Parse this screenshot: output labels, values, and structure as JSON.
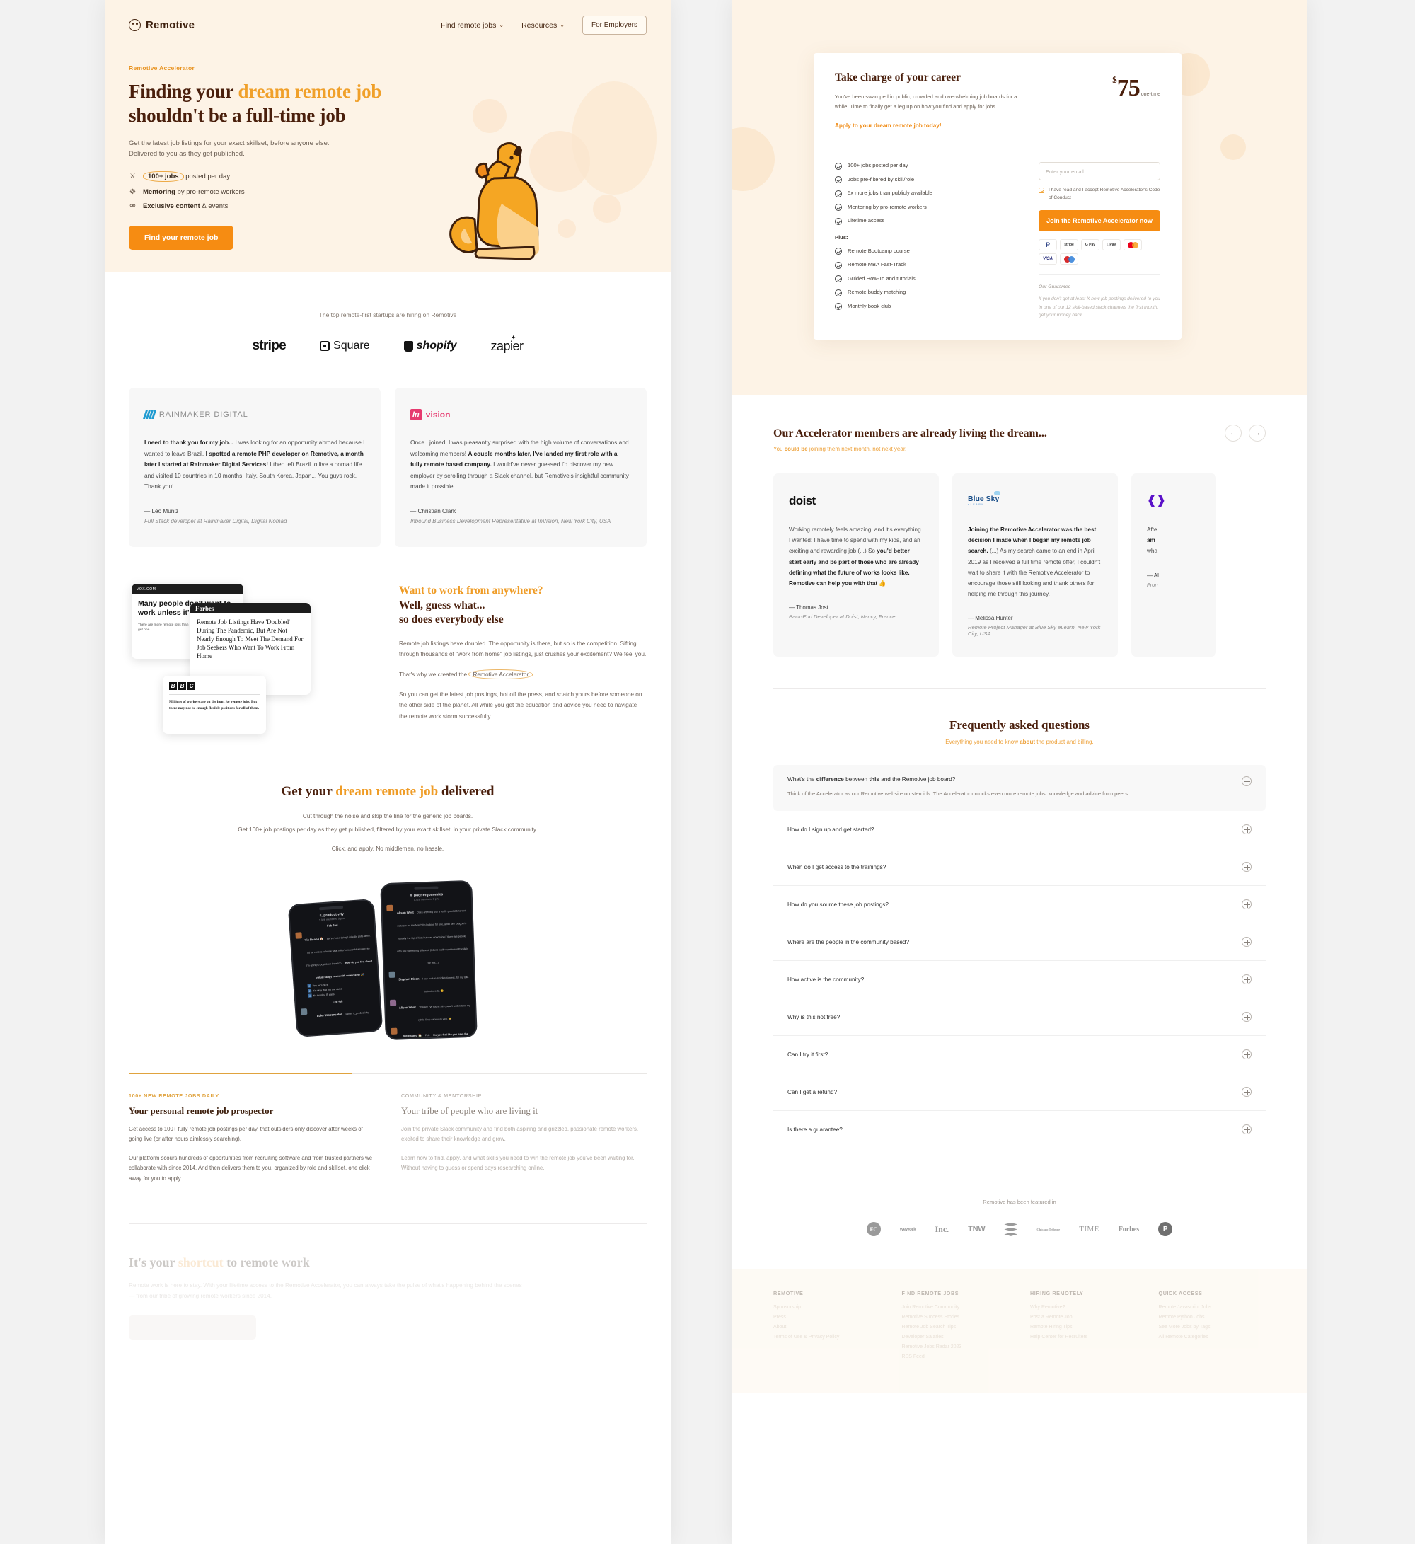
{
  "left": {
    "nav": {
      "brand": "Remotive",
      "links": [
        {
          "label": "Find remote jobs",
          "caret": "chevron-down-icon"
        },
        {
          "label": "Resources",
          "caret": "chevron-down-icon"
        }
      ],
      "employers_button": "For Employers"
    },
    "hero": {
      "eyebrow": "Remotive Accelerator",
      "title_1": "Finding your ",
      "title_accent": "dream remote job",
      "title_2": "shouldn't be a full-time job",
      "sub_line_1": "Get the latest job listings for your exact skillset, before anyone else.",
      "sub_line_2": "Delivered to you as they get published.",
      "features": [
        {
          "icon": "medal-icon",
          "strong": "100+ jobs",
          "rest": " posted per day",
          "circled": true
        },
        {
          "icon": "people-icon",
          "strong": "Mentoring",
          "rest": " by pro-remote workers",
          "circled": false
        },
        {
          "icon": "key-icon",
          "strong": "Exclusive content",
          "rest": " & events",
          "circled": false
        }
      ],
      "cta": "Find your remote job"
    },
    "logos": {
      "caption": "The top remote-first startups are hiring on Remotive",
      "items": [
        "stripe",
        "Square",
        "shopify",
        "zapier"
      ]
    },
    "testimonials": [
      {
        "company": "RAINMAKER DIGITAL",
        "company_part_1": "RAINMAKER",
        "company_part_2": "DIGITAL",
        "quote_bold_1": "I need to thank you for my job... ",
        "quote_plain_1": "I was looking for an opportunity abroad because I wanted to leave Brazil. ",
        "quote_bold_2": "I spotted a remote PHP developer on Remotive, a month later I started at Rainmaker Digital Services! ",
        "quote_plain_2": "I then left Brazil to live a nomad life and visited 10 countries in 10 months! Italy, South Korea, Japan... You guys rock. Thank you!",
        "author": "— Léo Muniz",
        "role": "Full Stack developer at Rainmaker Digital, Digital Nomad"
      },
      {
        "company": "InVision",
        "quote_plain_1": "Once I joined, I was pleasantly surprised with the high volume of conversations and welcoming members! ",
        "quote_bold_1": "A couple months later, I've landed my first role with a fully remote based company. ",
        "quote_plain_2": "I would've never guessed I'd discover my new employer by scrolling through a Slack channel, but Remotive's insightful community made it possible.",
        "author": "— Christian Clark",
        "role": "Inbound Business Development Representative at InVision, New York City, USA"
      }
    ],
    "press": {
      "cards": [
        {
          "source": "VOX.COM",
          "headline": "Many people don't want to work unless it's from home",
          "dek": "There are more remote jobs than ever. That doesn't mean you'll get one."
        },
        {
          "source": "Forbes",
          "headline": "Remote Job Listings Have 'Doubled' During The Pandemic, But Are Not Nearly Enough To Meet The Demand For Job Seekers Who Want To Work From Home"
        },
        {
          "source": "BBC",
          "headline": "Millions of workers are on the hunt for remote jobs. But there may not be enough flexible positions for all of them."
        }
      ],
      "heading_accent": "Want to work from anywhere?",
      "heading_line_2": "Well, guess what...",
      "heading_line_3": "so does everybody else",
      "para_1": "Remote job listings have doubled. The opportunity is there, but so is the competition. Sifting through thousands of \"work from home\" job listings, just crushes your excitement? We feel you.",
      "para_2_pre": "That's why we created the ",
      "para_2_hi": "Remotive Accelerator",
      "para_3": "So you can get the latest job postings, hot off the press, and snatch yours before someone on the other side of the planet. All while you get the education and advice you need to navigate the remote work storm successfully."
    },
    "delivered": {
      "title_1": "Get your ",
      "title_accent": "dream remote job",
      "title_2": " delivered",
      "para_1": "Cut through the noise and skip the line for the generic job boards.",
      "para_2": "Get 100+ job postings per day as they get published, filtered by your exact skillset, in your private Slack community.",
      "para_3": "Click, and apply. No middlemen, no hassle.",
      "phone_a": {
        "channel": "#_productivity",
        "members": "1,926 members, 5 pins",
        "date_1": "Feb 2nd",
        "m1_name": "Vic Boano 🏠",
        "m1_time": "5:22 PM",
        "m1_body": "We've been doing LinkedIn polls lately. I'd be curious to know what folks here would answer, so I'm going to post them here too.",
        "m1_poll_q": "How do you feel about virtual happy hours with coworkers? 🎉",
        "m1_opts": [
          "Yay, let's do it!",
          "It's okay, but not the same",
          "No thanks, I'll pass."
        ],
        "date_2": "Feb 4th",
        "m2_name": "Luke Vasconcelos",
        "m2_body": "joined #_productivity"
      },
      "phone_b": {
        "channel": "#_poor-ergonomics",
        "members": "1,726 members, 3 pins",
        "m1_name": "Alison West",
        "m1_time": "3:21 PM",
        "m1_body": "Does anybody use a really good talk-to-text software for the Mac? I'm looking for one, and I see Dragon is usually the top of lists but was wondering if there are people who use something different. (I don't really want to run Parallels for this...)",
        "m2_name": "Stephen Dixon",
        "m2_time": "4:01 PM",
        "m2_body": "I use built-in Siri dictation etc. for my talk-to-text needs. 😄",
        "m3_name": "Alison West",
        "m3_time": "4:04 PM",
        "m3_body": "Thanks! I've found Siri doesn't understand my (child-like) voice very well. 😄",
        "m4_name": "Vic Boano 🏠",
        "m4_time": "4:55 PM",
        "m4_pre": "Poll:",
        "m4_body": "Do you feel like you have the technology and equipment you need to do your job effectively while working from home? 😄",
        "m4_opts": [
          "Yes",
          "No",
          "Meh (tell us more in this thread)"
        ]
      }
    },
    "twocol": [
      {
        "kicker": "100+ NEW REMOTE JOBS DAILY",
        "title": "Your personal remote job prospector",
        "para_1": "Get access to 100+ fully remote job postings per day, that outsiders only discover after weeks of going live (or after hours aimlessly searching).",
        "para_2": "Our platform scours hundreds of opportunities from recruiting software and from trusted partners we collaborate with since 2014. And then delivers them to you, organized by role and skillset, one click away for you to apply."
      },
      {
        "kicker": "COMMUNITY & MENTORSHIP",
        "title": "Your tribe of people who are living it",
        "para_1": "Join the private Slack community and find both aspiring and grizzled, passionate remote workers, excited to share their knowledge and grow.",
        "para_2": "Learn how to find, apply, and what skills you need to win the remote job you've been waiting for. Without having to guess or spend days researching online."
      }
    ],
    "shortcut": {
      "title_1": "It's your ",
      "title_accent": "shortcut",
      "title_2": " to remote work",
      "para": "Remote work is here to stay. With your lifetime access to the Remotive Accelerator, you can always take the pulse of what's happening behind the scenes — from our tribe of growing remote workers since 2014."
    }
  },
  "right": {
    "price_card": {
      "title": "Take charge of your career",
      "para": "You've been swamped in public, crowded and overwhelming job boards for a while. Time to finally get a leg up on how you find and apply for jobs.",
      "cta_text": "Apply to your dream remote job today!",
      "currency": "$",
      "amount": "75",
      "period": "one-time",
      "features": [
        "100+ jobs posted per day",
        "Jobs pre-filtered by skill/role",
        "5x more jobs than publicly available",
        "Mentoring by pro-remote workers",
        "Lifetime access"
      ],
      "plus_label": "Plus:",
      "plus_features": [
        "Remote Bootcamp course",
        "Remote MBA Fast-Track",
        "Guided How-To and tutorials",
        "Remote buddy matching",
        "Monthly book club"
      ],
      "email_placeholder": "Enter your email",
      "consent": "I have read and I accept Remotive Accelerator's Code of Conduct",
      "join_button": "Join the Remotive Accelerator now",
      "payments": [
        "PayPal",
        "stripe",
        "G Pay",
        "Apple Pay",
        "Mastercard",
        "VISA",
        "Maestro"
      ],
      "guarantee_title": "Our Guarantee",
      "guarantee_body": "If you don't get at least X new job postings delivered to you in one of our 12 skill-based slack channels the first month, get your money back."
    },
    "members": {
      "heading": "Our Accelerator members are already living the dream...",
      "sub_pre": "You ",
      "sub_bold": "could be",
      "sub_post": " joining them next month, not next year.",
      "prev_icon": "arrow-left-icon",
      "next_icon": "arrow-right-icon",
      "cards": [
        {
          "company": "doist",
          "quote_plain_1": "Working remotely feels amazing, and it's everything I wanted: I have time to spend with my kids, and an exciting and rewarding job (...) So ",
          "quote_bold_1": "you'd better start early and be part of those who are already defining what the future of works looks like. Remotive can help you with that 👍",
          "author": "— Thomas Jost",
          "role": "Back-End Developer at Doist, Nancy, France"
        },
        {
          "company": "Blue Sky",
          "company_sub": "eLEARN",
          "quote_bold_1": "Joining the Remotive Accelerator was the best decision I made when I began my remote job search. ",
          "quote_plain_1": "(...) As my search came to an end in April 2019 as I received a full time remote offer, I couldn't wait to share it with the Remotive Accelerator to encourage those still looking and thank others for helping me through this journey.",
          "author": "— Melissa Hunter",
          "role": "Remote Project Manager at Blue Sky eLearn, New York City, USA"
        },
        {
          "company": "Frontify",
          "quote_plain_1": "Afte",
          "quote_bold_1": "am ",
          "quote_plain_2": "wha",
          "author": "— Al",
          "role": "Fron"
        }
      ]
    },
    "faq": {
      "heading": "Frequently asked questions",
      "sub_pre": "Everything you need to know ",
      "sub_bold": "about",
      "sub_post": " the product and billing.",
      "open_item": {
        "q_pre": "What's the ",
        "q_bold_1": "difference",
        "q_mid": " between ",
        "q_bold_2": "this",
        "q_post": " and the Remotive job board?",
        "answer": "Think of the Accelerator as our Remotive website on steroids. The Accelerator unlocks even more remote jobs, knowledge and advice from peers.",
        "toggle": "minus-icon"
      },
      "items": [
        {
          "q": "How do I sign up and get started?",
          "toggle": "plus-icon"
        },
        {
          "q": "When do I get access to the trainings?",
          "toggle": "plus-icon"
        },
        {
          "q": "How do you source these job postings?",
          "toggle": "plus-icon"
        },
        {
          "q": "Where are the people in the community based?",
          "toggle": "plus-icon"
        },
        {
          "q": "How active is the community?",
          "toggle": "plus-icon"
        },
        {
          "q": "Why is this not free?",
          "toggle": "plus-icon"
        },
        {
          "q": "Can I try it first?",
          "toggle": "plus-icon"
        },
        {
          "q": "Can I get a refund?",
          "toggle": "plus-icon"
        },
        {
          "q": "Is there a guarantee?",
          "toggle": "plus-icon"
        }
      ]
    },
    "featured": {
      "caption": "Remotive has been featured in",
      "logos": [
        "FC",
        "wework",
        "Inc.",
        "TNW",
        "Buffer",
        "Chicago Tribune",
        "TIME",
        "Forbes",
        "P"
      ]
    },
    "footer": {
      "columns": [
        {
          "title": "REMOTIVE",
          "links": [
            "Sponsorship",
            "Press",
            "About",
            "Terms of Use & Privacy Policy"
          ]
        },
        {
          "title": "FIND REMOTE JOBS",
          "links": [
            "Join Remotive Community",
            "Remotive Success Stories",
            "Remote Job Search Tips",
            "Developer Salaries",
            "Remotive Jobs Radar 2023",
            "RSS Feed"
          ]
        },
        {
          "title": "HIRING REMOTELY",
          "links": [
            "Why Remotive?",
            "Post a Remote Job",
            "Remote Hiring Tips",
            "Help Center for Recruiters"
          ]
        },
        {
          "title": "QUICK ACCESS",
          "links": [
            "Remote Javascript Jobs",
            "Remote Python Jobs",
            "See More Jobs by Tags",
            "All Remote Categories"
          ]
        }
      ]
    }
  },
  "colors": {
    "brand_orange": "#f68c12",
    "accent_amber": "#ef9c26",
    "dark_brown": "#4a1f0c",
    "hero_bg": "#fdf3e6",
    "card_bg": "#f7f7f7"
  }
}
